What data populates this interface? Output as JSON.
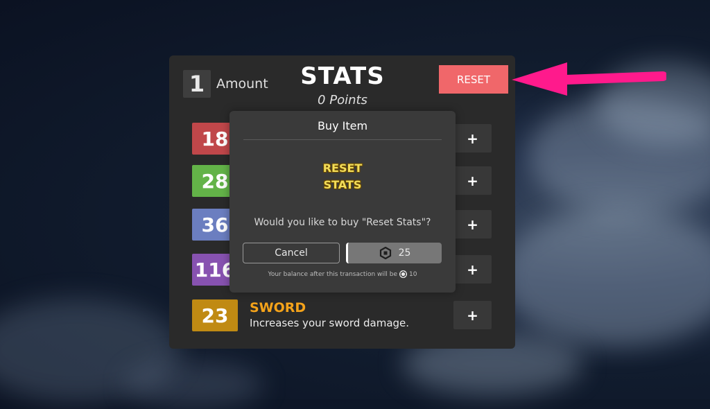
{
  "stats_panel": {
    "amount_value": "1",
    "amount_label": "Amount",
    "title": "STATS",
    "points": "0 Points",
    "reset_label": "RESET",
    "rows": [
      {
        "value": "18",
        "color": "#c0474a",
        "name": "",
        "description": ""
      },
      {
        "value": "28",
        "color": "#63b348",
        "name": "",
        "description": ""
      },
      {
        "value": "36",
        "color": "#6b7ec0",
        "name": "",
        "description": ""
      },
      {
        "value": "116",
        "color": "#8752b0",
        "name": "",
        "description": ""
      },
      {
        "value": "23",
        "color": "#c08a13",
        "name": "SWORD",
        "description": "Increases your sword damage."
      }
    ],
    "plus_label": "+"
  },
  "buy_dialog": {
    "title": "Buy Item",
    "item_image_text_line1": "RESET",
    "item_image_text_line2": "STATS",
    "prompt": "Would you like to buy \"Reset Stats\"?",
    "cancel_label": "Cancel",
    "price": "25",
    "balance_text": "Your balance after this transaction will be",
    "balance_value": "10"
  },
  "colors": {
    "accent_reset": "#f0676a",
    "arrow": "#ff1a8c",
    "stat_name": "#f5a31a"
  },
  "icons": {
    "currency": "robux-icon",
    "pointer": "pink-arrow-icon"
  }
}
